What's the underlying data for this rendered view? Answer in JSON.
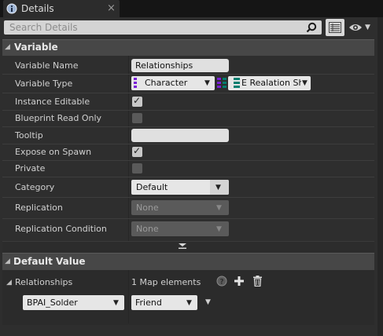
{
  "tab": {
    "title": "Details",
    "close": "×"
  },
  "search": {
    "placeholder": "Search Details"
  },
  "variable_section": {
    "title": "Variable",
    "rows": {
      "variable_name": {
        "label": "Variable Name",
        "value": "Relationships"
      },
      "variable_type": {
        "label": "Variable Type",
        "key_type": "Character",
        "value_type": "E Realation Ship"
      },
      "instance_editable": {
        "label": "Instance Editable",
        "checked": true
      },
      "blueprint_read_only": {
        "label": "Blueprint Read Only",
        "checked": false
      },
      "tooltip": {
        "label": "Tooltip",
        "value": ""
      },
      "expose_on_spawn": {
        "label": "Expose on Spawn",
        "checked": true
      },
      "private": {
        "label": "Private",
        "checked": false
      },
      "category": {
        "label": "Category",
        "value": "Default"
      },
      "replication": {
        "label": "Replication",
        "value": "None"
      },
      "replication_condition": {
        "label": "Replication Condition",
        "value": "None"
      }
    }
  },
  "default_section": {
    "title": "Default Value",
    "relationships": {
      "label": "Relationships",
      "summary": "1 Map elements",
      "entry_key": "BPAI_Solder",
      "entry_value": "Friend"
    }
  },
  "colors": {
    "panel": "#2e2e2e",
    "section_header": "#474747",
    "key_type_pin": "#7a1fd6",
    "value_type_pin": "#007d6e"
  }
}
